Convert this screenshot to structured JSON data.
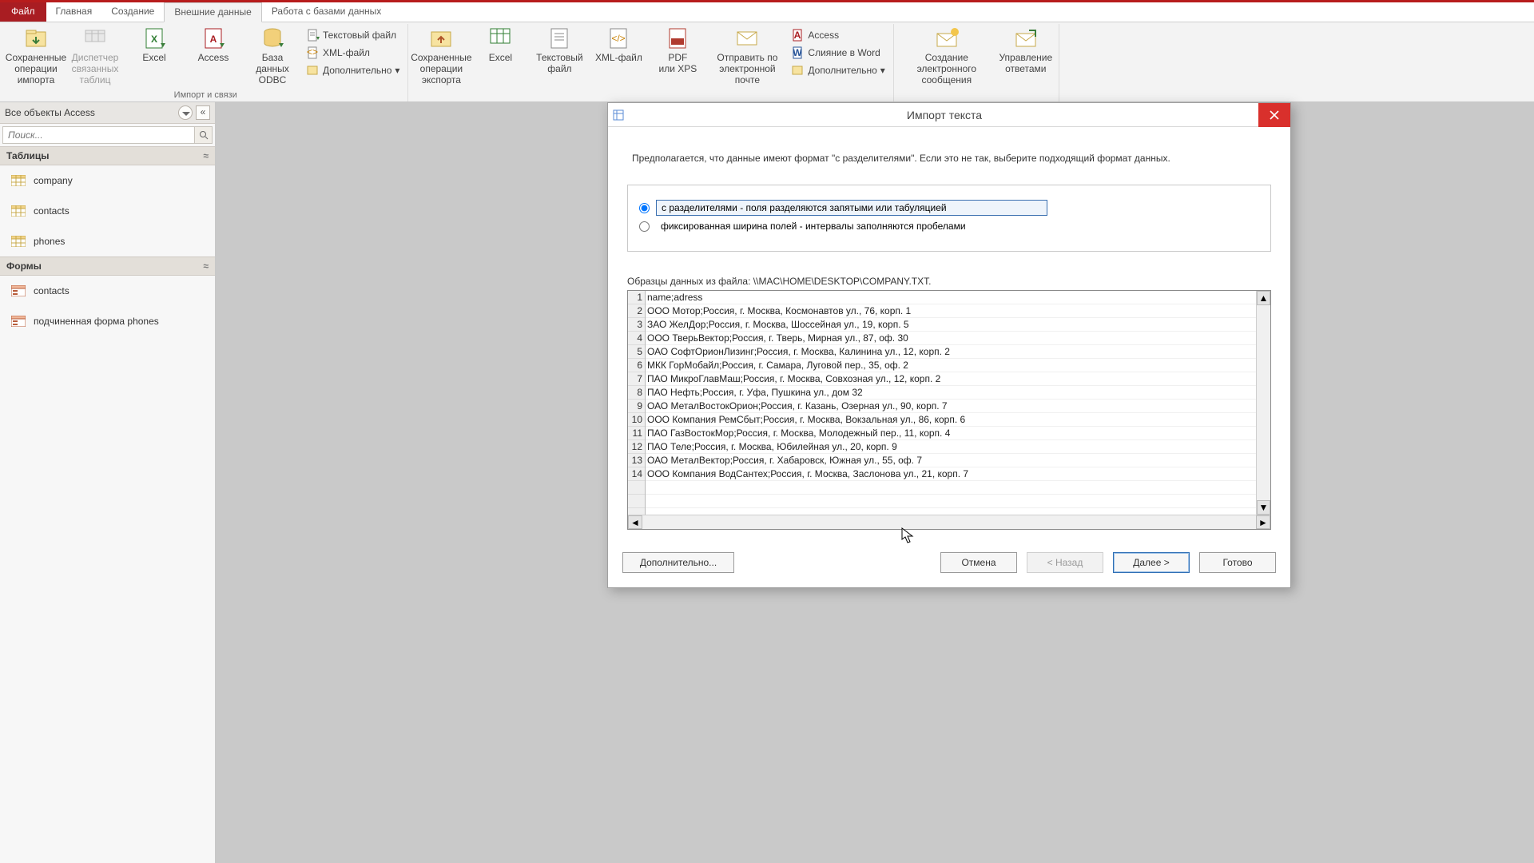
{
  "tabs": {
    "file": "Файл",
    "home": "Главная",
    "create": "Создание",
    "external": "Внешние данные",
    "db": "Работа с базами данных"
  },
  "ribbon": {
    "group_import_label": "Импорт и связи",
    "saved_import": "Сохраненные\nоперации импорта",
    "link_mgr": "Диспетчер\nсвязанных таблиц",
    "excel": "Excel",
    "access": "Access",
    "odbc": "База данных\nODBC",
    "text_file": "Текстовый файл",
    "xml_file": "XML-файл",
    "more": "Дополнительно",
    "saved_export": "Сохраненные\nоперации экспорта",
    "excel2": "Excel",
    "text2": "Текстовый\nфайл",
    "xml2": "XML-файл",
    "pdf": "PDF\nили XPS",
    "email": "Отправить по\nэлектронной почте",
    "access2": "Access",
    "word_merge": "Слияние в Word",
    "more2": "Дополнительно",
    "create_email": "Создание электронного\nсообщения",
    "manage_replies": "Управление\nответами"
  },
  "nav": {
    "title": "Все объекты Access",
    "search_placeholder": "Поиск...",
    "tables_header": "Таблицы",
    "forms_header": "Формы",
    "tables": [
      "company",
      "contacts",
      "phones"
    ],
    "forms": [
      "contacts",
      "подчиненная форма phones"
    ]
  },
  "dialog": {
    "title": "Импорт текста",
    "hint": "Предполагается, что данные имеют формат \"с разделителями\". Если это не так, выберите подходящий формат данных.",
    "radio_delim": "с разделителями - поля разделяются запятыми или табуляцией",
    "radio_fixed": "фиксированная ширина полей - интервалы заполняются пробелами",
    "sample_label": "Образцы данных из файла: \\\\MAC\\HOME\\DESKTOP\\COMPANY.TXT.",
    "lines": [
      "name;adress",
      "ООО Мотор;Россия, г. Москва, Космонавтов ул., 76, корп. 1",
      "ЗАО ЖелДор;Россия, г. Москва, Шоссейная ул., 19, корп. 5",
      "ООО ТверьВектор;Россия, г. Тверь, Мирная ул., 87, оф. 30",
      "ОАО СофтОрионЛизинг;Россия, г. Москва, Калинина ул., 12, корп. 2",
      "МКК ГорМобайл;Россия, г. Самара, Луговой пер., 35, оф. 2",
      "ПАО МикроГлавМаш;Россия, г. Москва, Совхозная ул., 12, корп. 2",
      "ПАО Нефть;Россия, г. Уфа, Пушкина ул., дом 32",
      "ОАО МеталВостокОрион;Россия, г. Казань, Озерная ул., 90, корп. 7",
      "ООО Компания РемСбыт;Россия, г. Москва, Вокзальная ул., 86, корп. 6",
      "ПАО ГазВостокМор;Россия, г. Москва, Молодежный пер., 11, корп. 4",
      "ПАО Теле;Россия, г. Москва, Юбилейная ул., 20, корп. 9",
      "ОАО МеталВектор;Россия, г. Хабаровск, Южная ул., 55, оф. 7",
      "ООО Компания ВодСантех;Россия, г. Москва, Заслонова ул., 21, корп. 7"
    ],
    "btn_more": "Дополнительно...",
    "btn_cancel": "Отмена",
    "btn_back": "< Назад",
    "btn_next": "Далее >",
    "btn_finish": "Готово"
  }
}
